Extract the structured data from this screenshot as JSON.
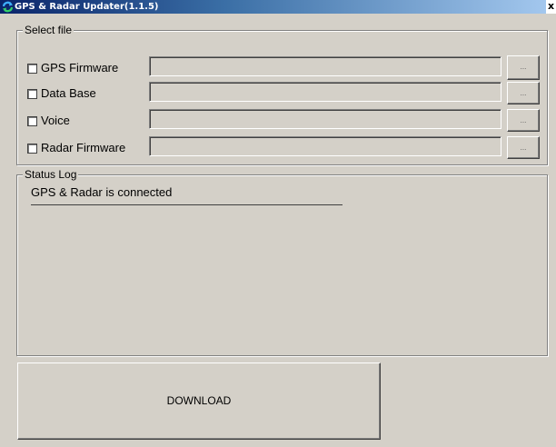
{
  "window": {
    "title": "GPS & Radar Updater(1.1.5)",
    "close_label": "x",
    "icon": "refresh-arrows-icon"
  },
  "select_file": {
    "legend": "Select file",
    "rows": [
      {
        "label": "GPS Firmware",
        "checked": false,
        "path": "",
        "browse_label": "..."
      },
      {
        "label": "Data Base",
        "checked": false,
        "path": "",
        "browse_label": "..."
      },
      {
        "label": "Voice",
        "checked": false,
        "path": "",
        "browse_label": "..."
      },
      {
        "label": "Radar Firmware",
        "checked": false,
        "path": "",
        "browse_label": "..."
      }
    ]
  },
  "status_log": {
    "legend": "Status Log",
    "message": "GPS & Radar is connected"
  },
  "download": {
    "label": "DOWNLOAD"
  }
}
